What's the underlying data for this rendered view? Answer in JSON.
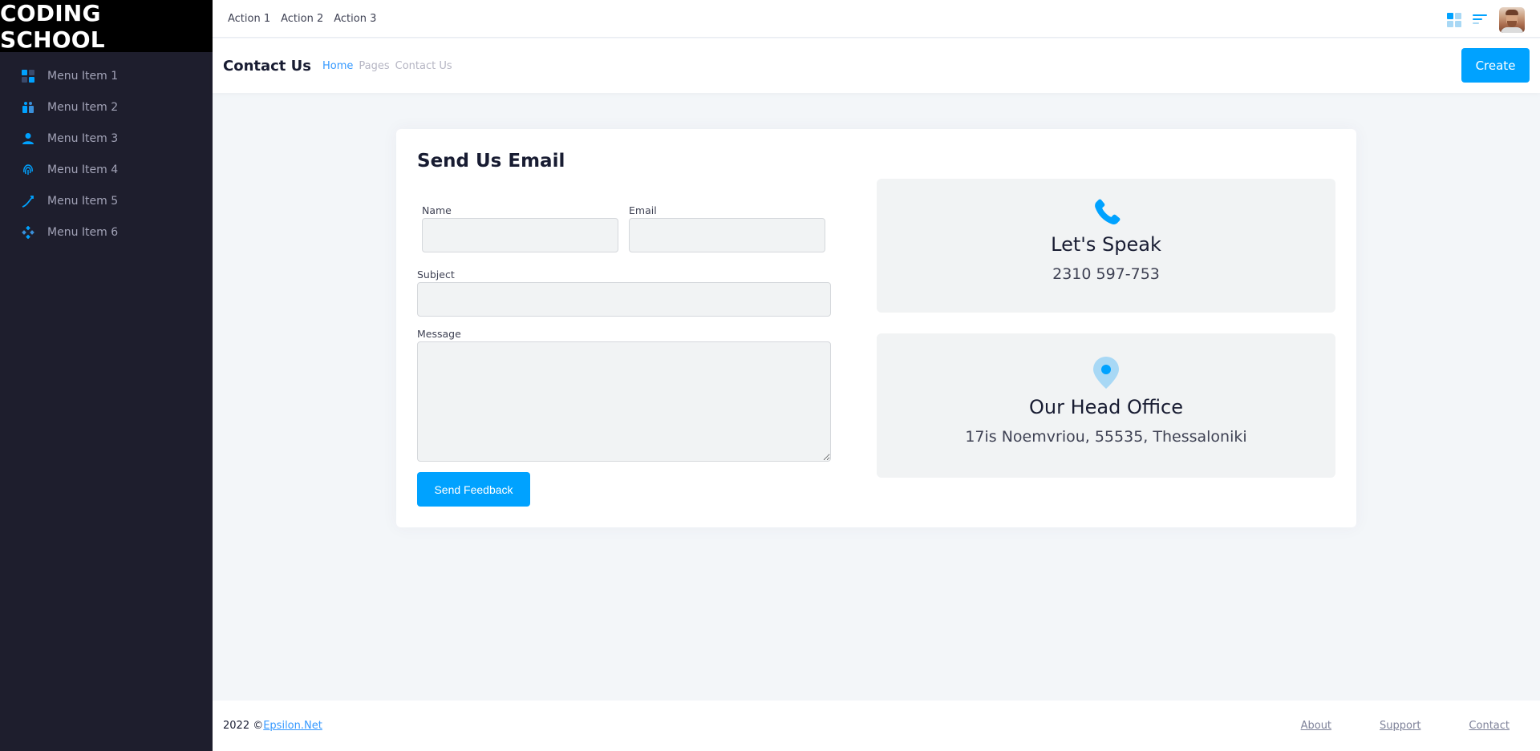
{
  "brand": {
    "name": "CODING SCHOOL"
  },
  "sidebar": {
    "items": [
      {
        "label": "Menu Item 1",
        "icon": "dashboard-grid-icon"
      },
      {
        "label": "Menu Item 2",
        "icon": "gift-icon"
      },
      {
        "label": "Menu Item 3",
        "icon": "user-icon"
      },
      {
        "label": "Menu Item 4",
        "icon": "fingerprint-icon"
      },
      {
        "label": "Menu Item 5",
        "icon": "pen-curve-icon"
      },
      {
        "label": "Menu Item 6",
        "icon": "diamond-dots-icon"
      }
    ]
  },
  "topbar": {
    "actions": [
      "Action 1",
      "Action 2",
      "Action 3"
    ],
    "icons": [
      "layout-grid-icon",
      "text-align-icon"
    ]
  },
  "subheader": {
    "title": "Contact Us",
    "breadcrumb": [
      "Home",
      "Pages",
      "Contact Us"
    ],
    "create_label": "Create"
  },
  "form": {
    "title": "Send Us Email",
    "name_label": "Name",
    "email_label": "Email",
    "subject_label": "Subject",
    "message_label": "Message",
    "name_value": "",
    "email_value": "",
    "subject_value": "",
    "message_value": "",
    "submit_label": "Send Feedback"
  },
  "info": {
    "phone_title": "Let's Speak",
    "phone_number": "2310 597-753",
    "office_title": "Our Head Office",
    "office_address": "17is Noemvriou, 55535, Thessaloniki"
  },
  "footer": {
    "copyright_prefix": "2022 ©",
    "company_link": "Epsilon.Net",
    "links": [
      "About",
      "Support",
      "Contact"
    ]
  },
  "colors": {
    "accent": "#00a2ff",
    "sidebar_bg": "#1e1e2d",
    "brand_bg": "#000000",
    "page_bg": "#f3f6f9",
    "box_bg": "#f1f3f4"
  }
}
